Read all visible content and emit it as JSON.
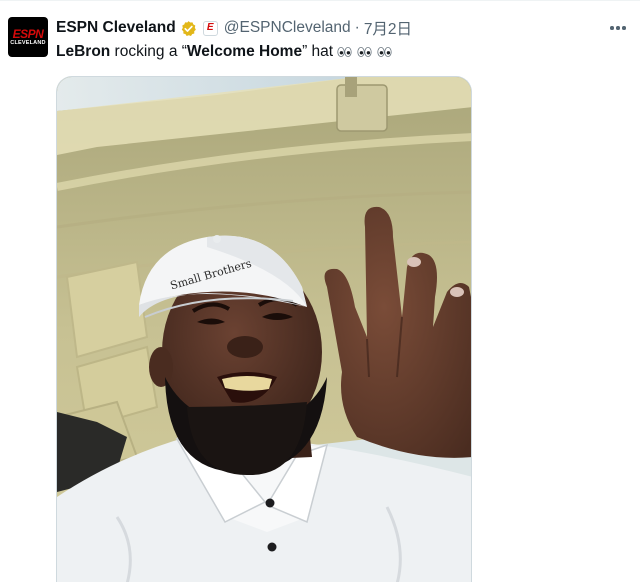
{
  "account": {
    "display_name": "ESPN Cleveland",
    "handle": "@ESPNCleveland",
    "separator": "·",
    "date": "7月2日",
    "avatar_logo_top": "ESPN",
    "avatar_logo_bottom": "CLEVELAND",
    "affiliate_badge_letter": "E",
    "verified_color": "#e2b719"
  },
  "tweet": {
    "name_part": "LeBron",
    "text_middle": " rocking a “",
    "highlight": "Welcome Home",
    "text_end": "” hat "
  },
  "media": {
    "hat_text": "Small Brothers"
  },
  "icons": {
    "verified": "verified-badge-icon",
    "more": "more-options-icon",
    "eyes": "eyes-emoji-icon"
  }
}
